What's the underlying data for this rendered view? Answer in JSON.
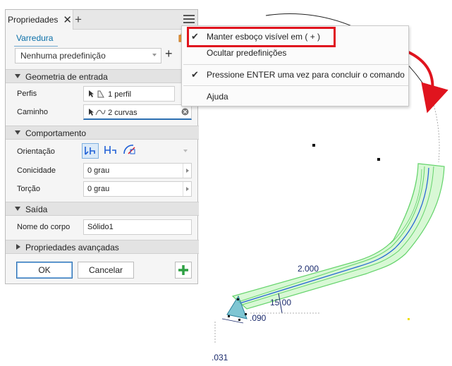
{
  "panel": {
    "tab_title": "Propriedades",
    "close_glyph": "✕",
    "add_glyph": "+",
    "menu_icon": "hamburger-menu-icon",
    "command_name": "Varredura",
    "preset": {
      "value": "Nenhuma predefinição",
      "add_glyph": "+"
    },
    "sections": {
      "input_geometry": "Geometria de entrada",
      "behavior": "Comportamento",
      "output": "Saída",
      "advanced": "Propriedades avançadas"
    },
    "fields": {
      "profiles": {
        "label": "Perfis",
        "value": "1 perfil"
      },
      "path": {
        "label": "Caminho",
        "value": "2 curvas"
      },
      "orientation": {
        "label": "Orientação"
      },
      "taper": {
        "label": "Conicidade",
        "value": "0 grau"
      },
      "twist": {
        "label": "Torção",
        "value": "0 grau"
      },
      "body_name": {
        "label": "Nome do corpo",
        "value": "Sólido1"
      }
    },
    "buttons": {
      "ok": "OK",
      "cancel": "Cancelar"
    },
    "colors": {
      "accent": "#0a6fa8",
      "apply_green": "#2ea043"
    }
  },
  "context_menu": {
    "items": [
      {
        "label": "Manter esboço visível em ( + )",
        "checked": true,
        "highlighted": true
      },
      {
        "label": "Ocultar predefinições",
        "checked": false
      },
      {
        "label": "Pressione ENTER uma vez para concluir o comando",
        "checked": true
      },
      {
        "label": "Ajuda",
        "checked": false
      }
    ],
    "highlight_color": "#e0141e"
  },
  "canvas": {
    "dimensions": [
      "2.000",
      "15.00",
      ".090",
      ".031"
    ],
    "sweep_color": "#7de07d",
    "path_color": "#1f5fd6"
  }
}
